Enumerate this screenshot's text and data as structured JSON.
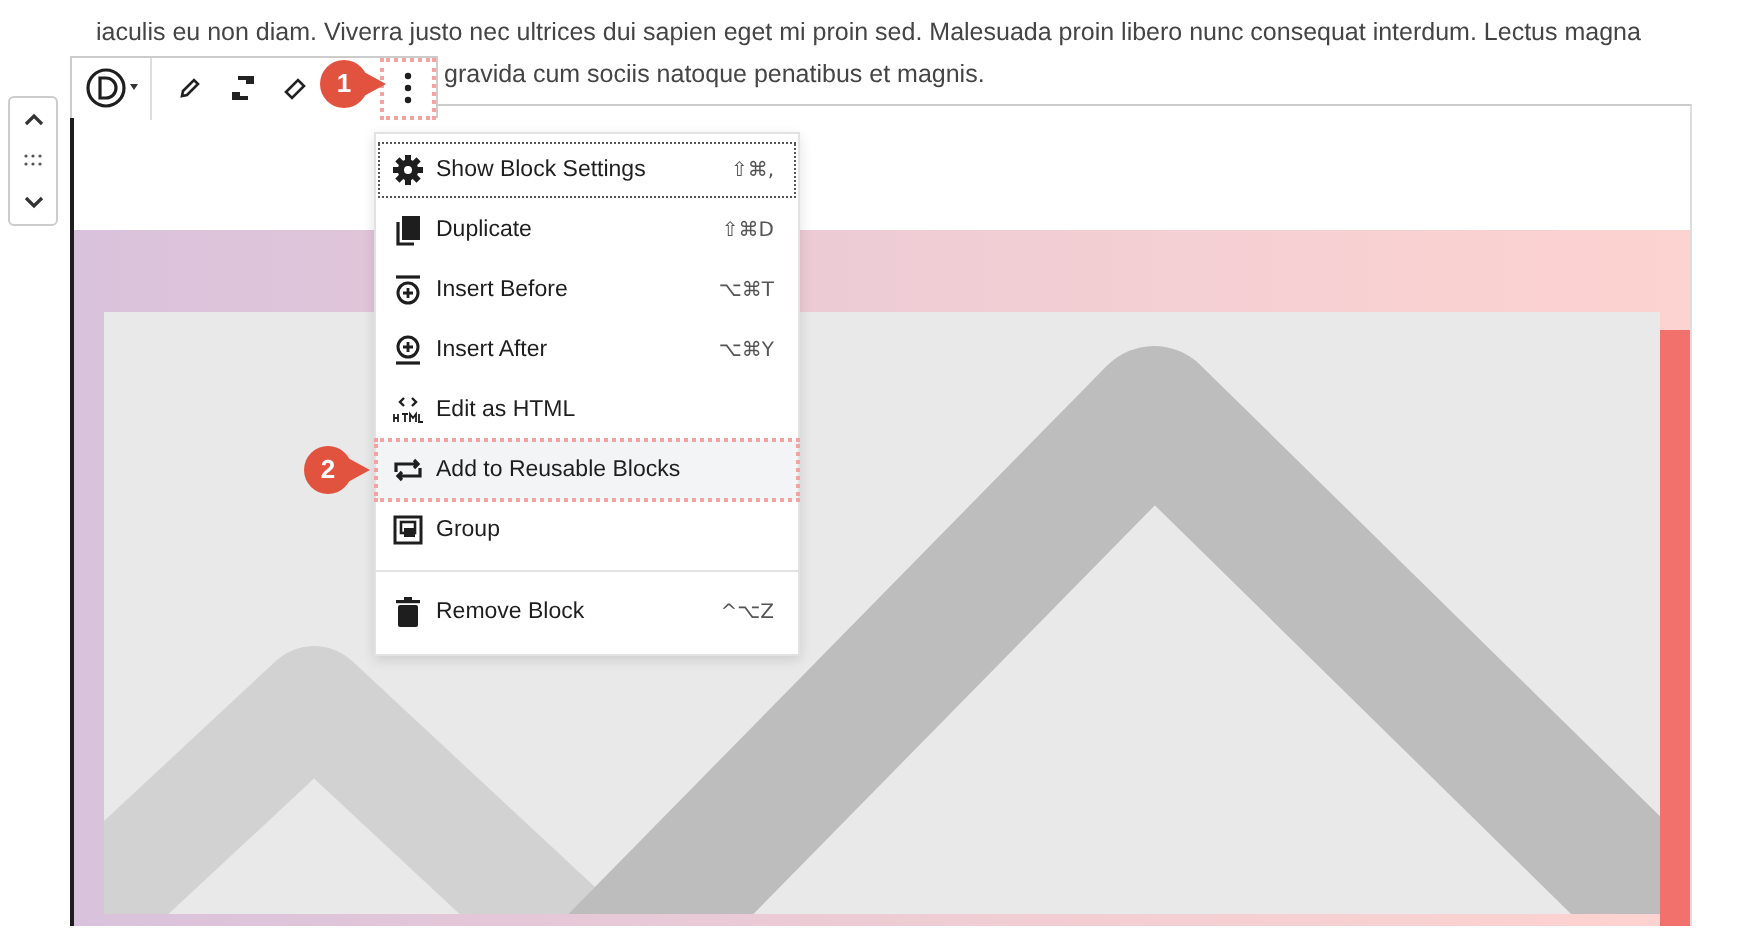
{
  "paragraph": {
    "lines": [
      "iaculis eu non diam. Viverra justo nec ultrices dui sapien eget mi proin sed. Malesuada proin libero nunc consequat interdum. Lectus magna",
      "gravida cum sociis natoque penatibus et magnis."
    ]
  },
  "toolbar": {
    "more_callout": "1"
  },
  "menu": {
    "sections": [
      [
        {
          "kind": "gear",
          "label": "Show Block Settings",
          "shortcut": "⇧⌘,",
          "focused": true,
          "highlighted": false
        },
        {
          "kind": "duplicate",
          "label": "Duplicate",
          "shortcut": "⇧⌘D",
          "focused": false,
          "highlighted": false
        },
        {
          "kind": "insert-before",
          "label": "Insert Before",
          "shortcut": "⌥⌘T",
          "focused": false,
          "highlighted": false
        },
        {
          "kind": "insert-after",
          "label": "Insert After",
          "shortcut": "⌥⌘Y",
          "focused": false,
          "highlighted": false
        },
        {
          "kind": "html",
          "label": "Edit as HTML",
          "focused": false,
          "highlighted": false
        },
        {
          "kind": "reusable",
          "label": "Add to Reusable Blocks",
          "focused": false,
          "highlighted": true,
          "callout": "2"
        },
        {
          "kind": "group",
          "label": "Group",
          "focused": false,
          "highlighted": false
        }
      ],
      [
        {
          "kind": "trash",
          "label": "Remove Block",
          "shortcut": "^⌥Z",
          "focused": false,
          "highlighted": false
        }
      ]
    ]
  }
}
